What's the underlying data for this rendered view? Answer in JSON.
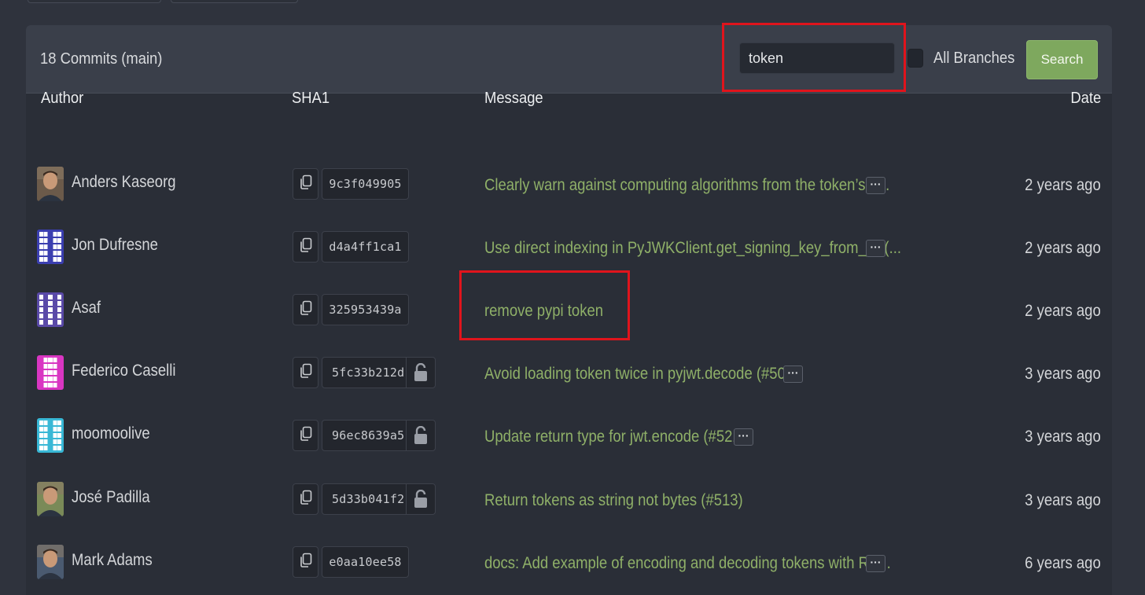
{
  "header": {
    "commit_count": "18 Commits (main)",
    "search_value": "token",
    "all_branches_label": "All Branches",
    "search_button": "Search"
  },
  "columns": {
    "author": "Author",
    "sha": "SHA1",
    "message": "Message",
    "date": "Date"
  },
  "commits": [
    {
      "author": "Anders Kaseorg",
      "sha": "9c3f049905",
      "message": "Clearly warn against computing algorithms from the token’s a...",
      "date": "2 years ago",
      "locked": false,
      "has_more": true
    },
    {
      "author": "Jon Dufresne",
      "sha": "d4a4ff1ca1",
      "message": "Use direct indexing in PyJWKClient.get_signing_key_from_jwt(...",
      "date": "2 years ago",
      "locked": false,
      "has_more": true
    },
    {
      "author": "Asaf",
      "sha": "325953439a",
      "message": "remove pypi token",
      "date": "2 years ago",
      "locked": false,
      "has_more": false
    },
    {
      "author": "Federico Caselli",
      "sha": "5fc33b212d",
      "message": "Avoid loading token twice in pyjwt.decode (#506)",
      "date": "3 years ago",
      "locked": true,
      "has_more": true
    },
    {
      "author": "moomoolive",
      "sha": "96ec8639a5",
      "message": "Update return type for jwt.encode (#521)",
      "date": "3 years ago",
      "locked": true,
      "has_more": true
    },
    {
      "author": "José Padilla",
      "sha": "5d33b041f2",
      "message": "Return tokens as string not bytes (#513)",
      "date": "3 years ago",
      "locked": true,
      "has_more": false
    },
    {
      "author": "Mark Adams",
      "sha": "e0aa10ee58",
      "message": "docs: Add example of encoding and decoding tokens with RS...",
      "date": "6 years ago",
      "locked": false,
      "has_more": true
    }
  ],
  "more_label": "···",
  "icons": {
    "copy": "copy-icon",
    "lock": "unlock-icon",
    "more": "ellipsis-icon"
  },
  "colors": {
    "accent_green": "#7ea85e",
    "message_link": "#8fb068",
    "highlight": "#e0141c"
  }
}
